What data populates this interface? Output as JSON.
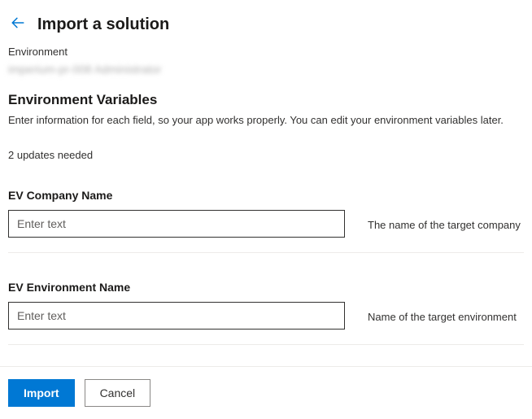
{
  "header": {
    "title": "Import a solution"
  },
  "environment": {
    "label": "Environment",
    "value": "imperium-pr-008 Administrator"
  },
  "section": {
    "title": "Environment Variables",
    "description": "Enter information for each field, so your app works properly. You can edit your environment variables later.",
    "updates": "2 updates needed"
  },
  "fields": {
    "company": {
      "label": "EV Company Name",
      "placeholder": "Enter text",
      "value": "",
      "help": "The name of the target company"
    },
    "envname": {
      "label": "EV Environment Name",
      "placeholder": "Enter text",
      "value": "",
      "help": "Name of the target environment"
    }
  },
  "footer": {
    "import": "Import",
    "cancel": "Cancel"
  }
}
